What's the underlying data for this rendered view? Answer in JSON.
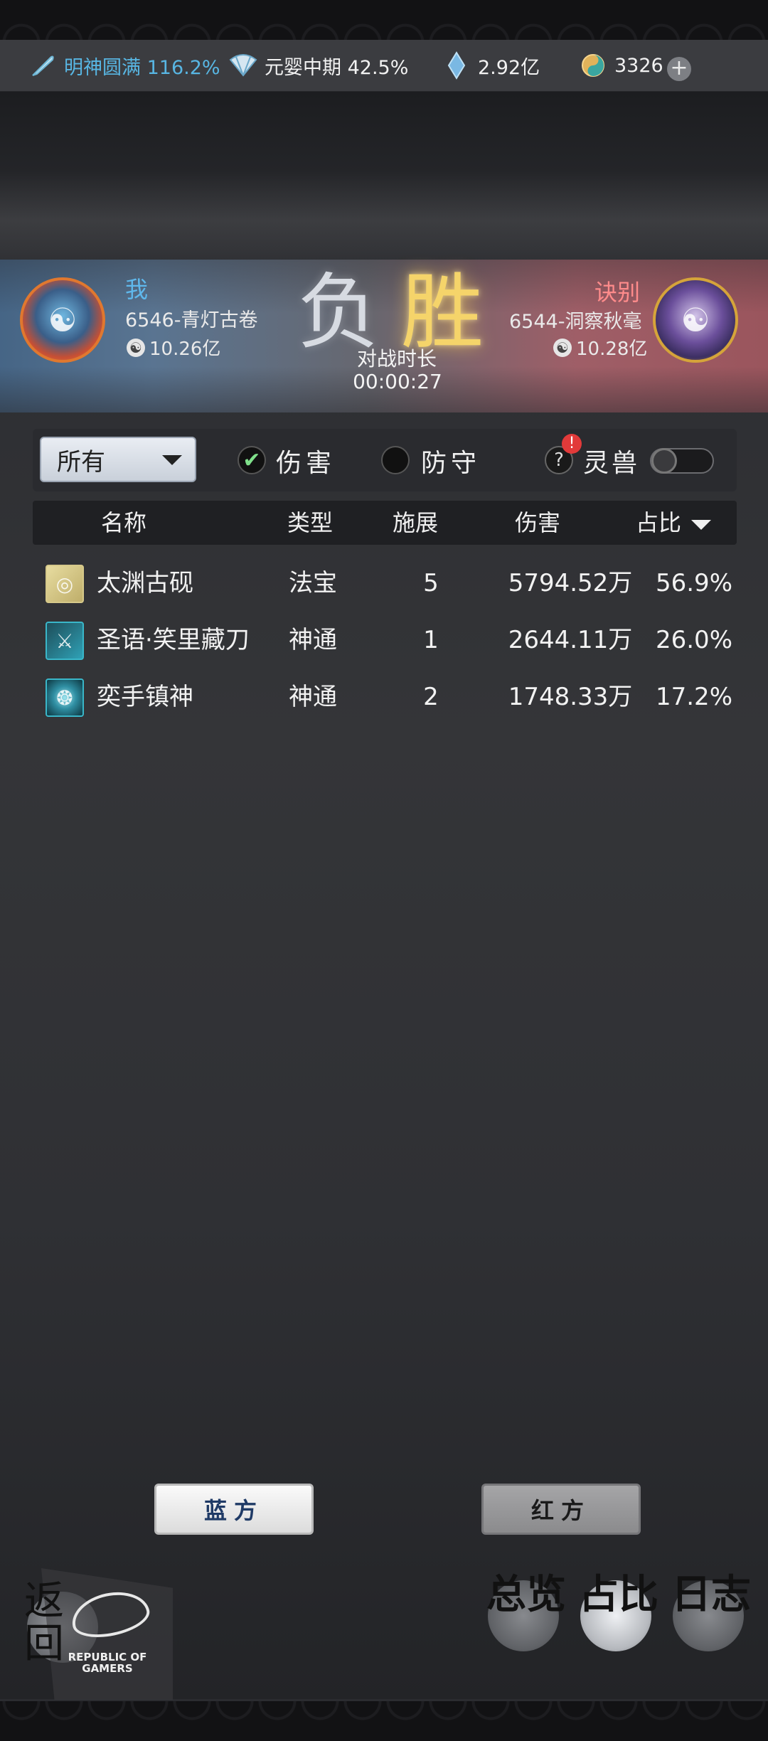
{
  "status_bar": {
    "cultivation": "明神圆满 116.2%",
    "realm": "元婴中期 42.5%",
    "spirit_stones": "2.92亿",
    "jade": "3326",
    "icons": [
      "feather-icon",
      "fan-icon",
      "crystal-icon",
      "jade-coin-icon",
      "plus-icon"
    ]
  },
  "battle": {
    "player": {
      "name": "我",
      "server": "6546-青灯古卷",
      "power": "10.26亿"
    },
    "opponent": {
      "name": "诀别",
      "server": "6544-洞察秋毫",
      "power": "10.28亿"
    },
    "result_left": "负",
    "result_right": "胜",
    "duration_label": "对战时长",
    "duration": "00:00:27"
  },
  "filters": {
    "dropdown_value": "所有",
    "damage_label": "伤害",
    "defense_label": "防守",
    "spirit_beast_label": "灵兽",
    "damage_checked": true,
    "defense_checked": false,
    "spirit_beast_on": false
  },
  "table": {
    "headers": {
      "name": "名称",
      "type": "类型",
      "casts": "施展",
      "damage": "伤害",
      "share": "占比"
    },
    "rows": [
      {
        "icon": "inkstone-icon",
        "name": "太渊古砚",
        "type": "法宝",
        "casts": "5",
        "damage": "5794.52万",
        "share": "56.9%"
      },
      {
        "icon": "blade-icon",
        "name": "圣语·笑里藏刀",
        "type": "神通",
        "casts": "1",
        "damage": "2644.11万",
        "share": "26.0%"
      },
      {
        "icon": "spirit-orb-icon",
        "name": "奕手镇神",
        "type": "神通",
        "casts": "2",
        "damage": "1748.33万",
        "share": "17.2%"
      }
    ]
  },
  "side_buttons": {
    "blue": "蓝方",
    "red": "红方"
  },
  "bottom_nav": {
    "back": "返回",
    "overview": "总览",
    "share": "占比",
    "log": "日志",
    "rog_text": "REPUBLIC OF GAMERS"
  },
  "colors": {
    "player_name": "#5fb8ec",
    "opponent_name": "#ff8b8b",
    "win_gold": "#f5d46a",
    "cultivation_text": "#58b6e3"
  }
}
